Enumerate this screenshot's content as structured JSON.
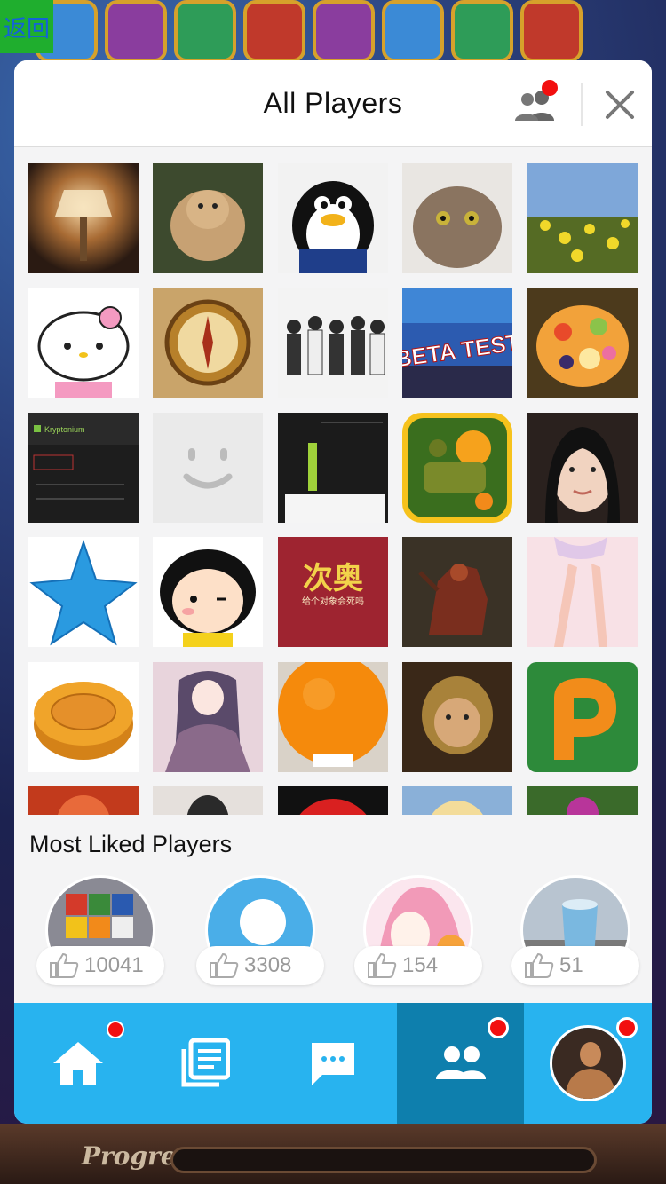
{
  "colors": {
    "accent": "#28b3ef",
    "accent_active": "#0e7fad",
    "badge": "#f20f0f",
    "back_button": "#1fae2e"
  },
  "game_background": {
    "back_label": "返回",
    "progress_label": "Progress"
  },
  "header": {
    "title": "All Players",
    "friends_icon": "friends-icon",
    "close_icon": "close-icon"
  },
  "players": [
    {
      "name": "player-avatar",
      "icon": "lamp-photo"
    },
    {
      "name": "player-avatar",
      "icon": "lioness-photo"
    },
    {
      "name": "player-avatar",
      "icon": "penguin-avatar"
    },
    {
      "name": "player-avatar",
      "icon": "cat-photo"
    },
    {
      "name": "player-avatar",
      "icon": "flowers-photo"
    },
    {
      "name": "player-avatar",
      "icon": "hello-kitty-avatar"
    },
    {
      "name": "player-avatar",
      "icon": "compass-photo"
    },
    {
      "name": "player-avatar",
      "icon": "group-photo"
    },
    {
      "name": "player-avatar",
      "icon": "beta-test-banner",
      "text": "BETA TEST"
    },
    {
      "name": "player-avatar",
      "icon": "fruit-photo"
    },
    {
      "name": "player-avatar",
      "icon": "screenshot-dark",
      "text": "Kryptonium"
    },
    {
      "name": "player-avatar",
      "icon": "default-smiley-avatar"
    },
    {
      "name": "player-avatar",
      "icon": "screenshot-dark-green"
    },
    {
      "name": "player-avatar",
      "icon": "cannon-game-icon"
    },
    {
      "name": "player-avatar",
      "icon": "girl-portrait"
    },
    {
      "name": "player-avatar",
      "icon": "blue-star"
    },
    {
      "name": "player-avatar",
      "icon": "cartoon-girl"
    },
    {
      "name": "player-avatar",
      "icon": "red-calligraphy",
      "text": "次奥",
      "subtext": "给个对象会死吗"
    },
    {
      "name": "player-avatar",
      "icon": "warhorse-art"
    },
    {
      "name": "player-avatar",
      "icon": "pink-legs-art"
    },
    {
      "name": "player-avatar",
      "icon": "mooncake-photo"
    },
    {
      "name": "player-avatar",
      "icon": "anime-girl-art"
    },
    {
      "name": "player-avatar",
      "icon": "orange-photo"
    },
    {
      "name": "player-avatar",
      "icon": "warrior-photo"
    },
    {
      "name": "player-avatar",
      "icon": "green-p-logo"
    },
    {
      "name": "player-avatar",
      "icon": "red-partial"
    },
    {
      "name": "player-avatar",
      "icon": "man-partial"
    },
    {
      "name": "player-avatar",
      "icon": "red-circle-partial"
    },
    {
      "name": "player-avatar",
      "icon": "anime-blonde-partial"
    },
    {
      "name": "player-avatar",
      "icon": "flower-partial"
    }
  ],
  "most_liked": {
    "title": "Most Liked Players",
    "items": [
      {
        "count": "10041",
        "icon": "rubik-cube-photo"
      },
      {
        "count": "3308",
        "icon": "default-circle-avatar"
      },
      {
        "count": "154",
        "icon": "anime-pink-girl"
      },
      {
        "count": "51",
        "icon": "cup-photo"
      }
    ]
  },
  "tabbar": {
    "tabs": [
      {
        "icon": "home-icon",
        "badge": true,
        "active": false
      },
      {
        "icon": "news-icon",
        "badge": false,
        "active": false
      },
      {
        "icon": "chat-icon",
        "badge": false,
        "active": false
      },
      {
        "icon": "players-icon",
        "badge": true,
        "active": true
      },
      {
        "icon": "profile-avatar",
        "badge": true,
        "active": false
      }
    ]
  }
}
